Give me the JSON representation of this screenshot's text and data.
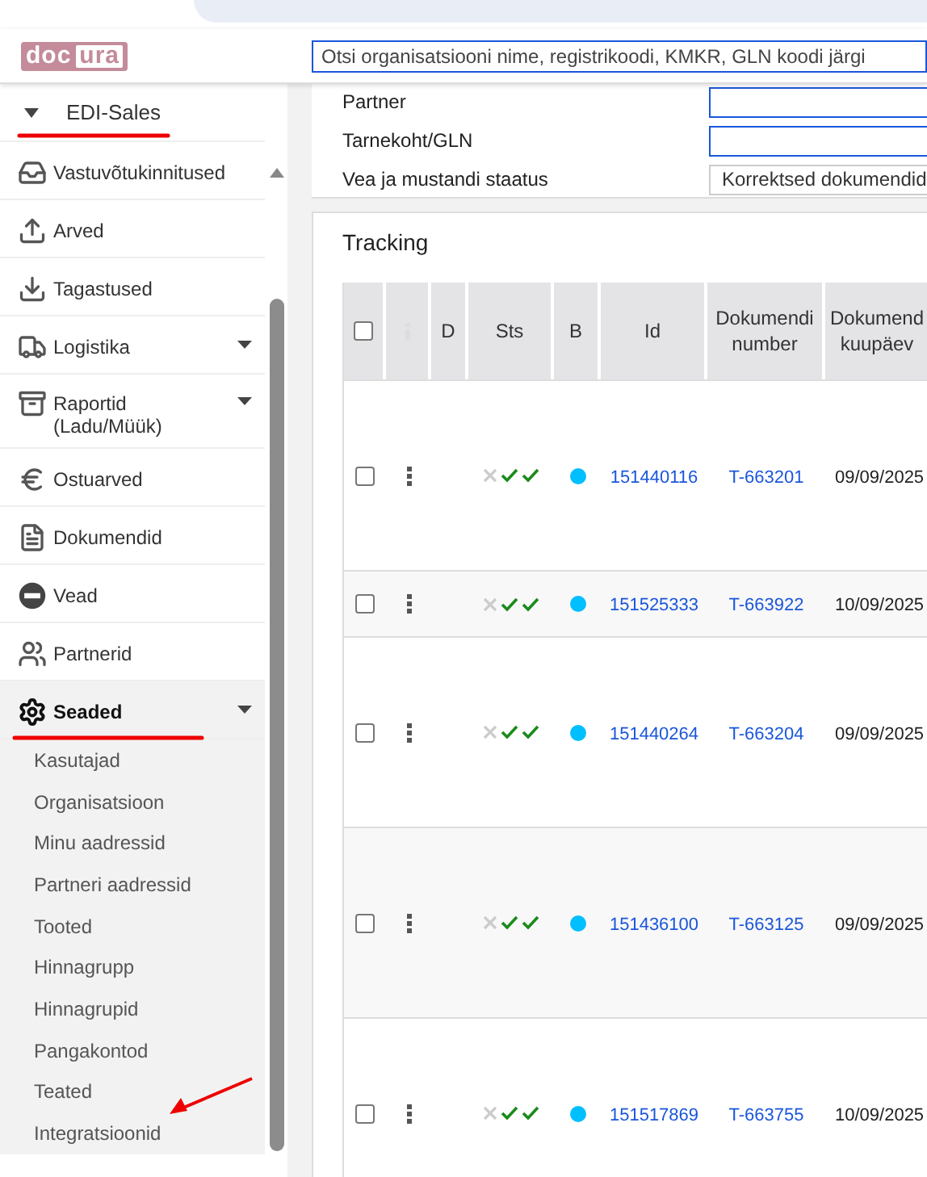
{
  "header": {
    "logo": [
      "doc",
      "ura"
    ],
    "search": {
      "placeholder": "Otsi organisatsiooni nime, registrikoodi, KMKR, GLN koodi järgi"
    }
  },
  "sidebar": {
    "top_item": {
      "label": "EDI-Sales",
      "expanded": true
    },
    "items": [
      {
        "kind": "inbox",
        "label": "Vastuvõtukinnitused",
        "submenu": false,
        "selected": false
      },
      {
        "kind": "upload",
        "label": "Arved",
        "submenu": false,
        "selected": false
      },
      {
        "kind": "download",
        "label": "Tagastused",
        "submenu": false,
        "selected": false
      },
      {
        "kind": "truck",
        "label": "Logistika",
        "submenu": true,
        "selected": false
      },
      {
        "kind": "archive",
        "label": "Raportid (Ladu/Müük)",
        "submenu": true,
        "selected": false
      },
      {
        "kind": "euro",
        "label": "Ostuarved",
        "submenu": false,
        "selected": false
      },
      {
        "kind": "file",
        "label": "Dokumendid",
        "submenu": false,
        "selected": false
      },
      {
        "kind": "minus",
        "label": "Vead",
        "submenu": false,
        "selected": false
      },
      {
        "kind": "people",
        "label": "Partnerid",
        "submenu": false,
        "selected": false
      },
      {
        "kind": "gear",
        "label": "Seaded",
        "submenu": true,
        "selected": true,
        "children": [
          "Kasutajad",
          "Organisatsioon",
          "Minu aadressid",
          "Partneri aadressid",
          "Tooted",
          "Hinnagrupp",
          "Hinnagrupid",
          "Pangakontod",
          "Teated",
          "Integratsioonid"
        ]
      }
    ]
  },
  "filters": [
    {
      "kind": "input",
      "label": "Partner"
    },
    {
      "kind": "input",
      "label": "Tarnekoht/GLN"
    },
    {
      "kind": "select",
      "label": "Vea ja mustandi staatus",
      "value": "Korrektsed dokumendid"
    }
  ],
  "tracking": {
    "title": "Tracking",
    "columns": [
      {
        "kind": "checkbox",
        "checked": false
      },
      {
        "kind": "info"
      },
      {
        "kind": "text",
        "label": "D"
      },
      {
        "kind": "text",
        "label": "Sts"
      },
      {
        "kind": "text",
        "label": "B"
      },
      {
        "kind": "text",
        "label": "Id"
      },
      {
        "kind": "text",
        "label": "Dokumendi number"
      },
      {
        "kind": "text",
        "label": "Dokumend kuupäev"
      }
    ],
    "rows": [
      {
        "checked": false,
        "sts": [
          {
            "ok": false
          },
          {
            "ok": true
          },
          {
            "ok": true
          }
        ],
        "color": "#00bfff",
        "id": "151440116",
        "number": "T-663201",
        "date": "09/09/2025"
      },
      {
        "checked": false,
        "sts": [
          {
            "ok": false
          },
          {
            "ok": true
          },
          {
            "ok": true
          }
        ],
        "color": "#00bfff",
        "id": "151525333",
        "number": "T-663922",
        "date": "10/09/2025"
      },
      {
        "checked": false,
        "sts": [
          {
            "ok": false
          },
          {
            "ok": true
          },
          {
            "ok": true
          }
        ],
        "color": "#00bfff",
        "id": "151440264",
        "number": "T-663204",
        "date": "09/09/2025"
      },
      {
        "checked": false,
        "sts": [
          {
            "ok": false
          },
          {
            "ok": true
          },
          {
            "ok": true
          }
        ],
        "color": "#00bfff",
        "id": "151436100",
        "number": "T-663125",
        "date": "09/09/2025"
      },
      {
        "checked": false,
        "sts": [
          {
            "ok": false
          },
          {
            "ok": true
          },
          {
            "ok": true
          }
        ],
        "color": "#00bfff",
        "id": "151517869",
        "number": "T-663755",
        "date": "10/09/2025"
      }
    ]
  }
}
